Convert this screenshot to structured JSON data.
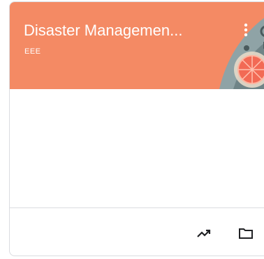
{
  "card": {
    "title": "Disaster Managemen...",
    "section": "EEE",
    "banner_color": "#f48a64",
    "icons": {
      "menu": "more-vert-icon",
      "analytics": "trending-up-icon",
      "folder": "folder-icon"
    }
  }
}
